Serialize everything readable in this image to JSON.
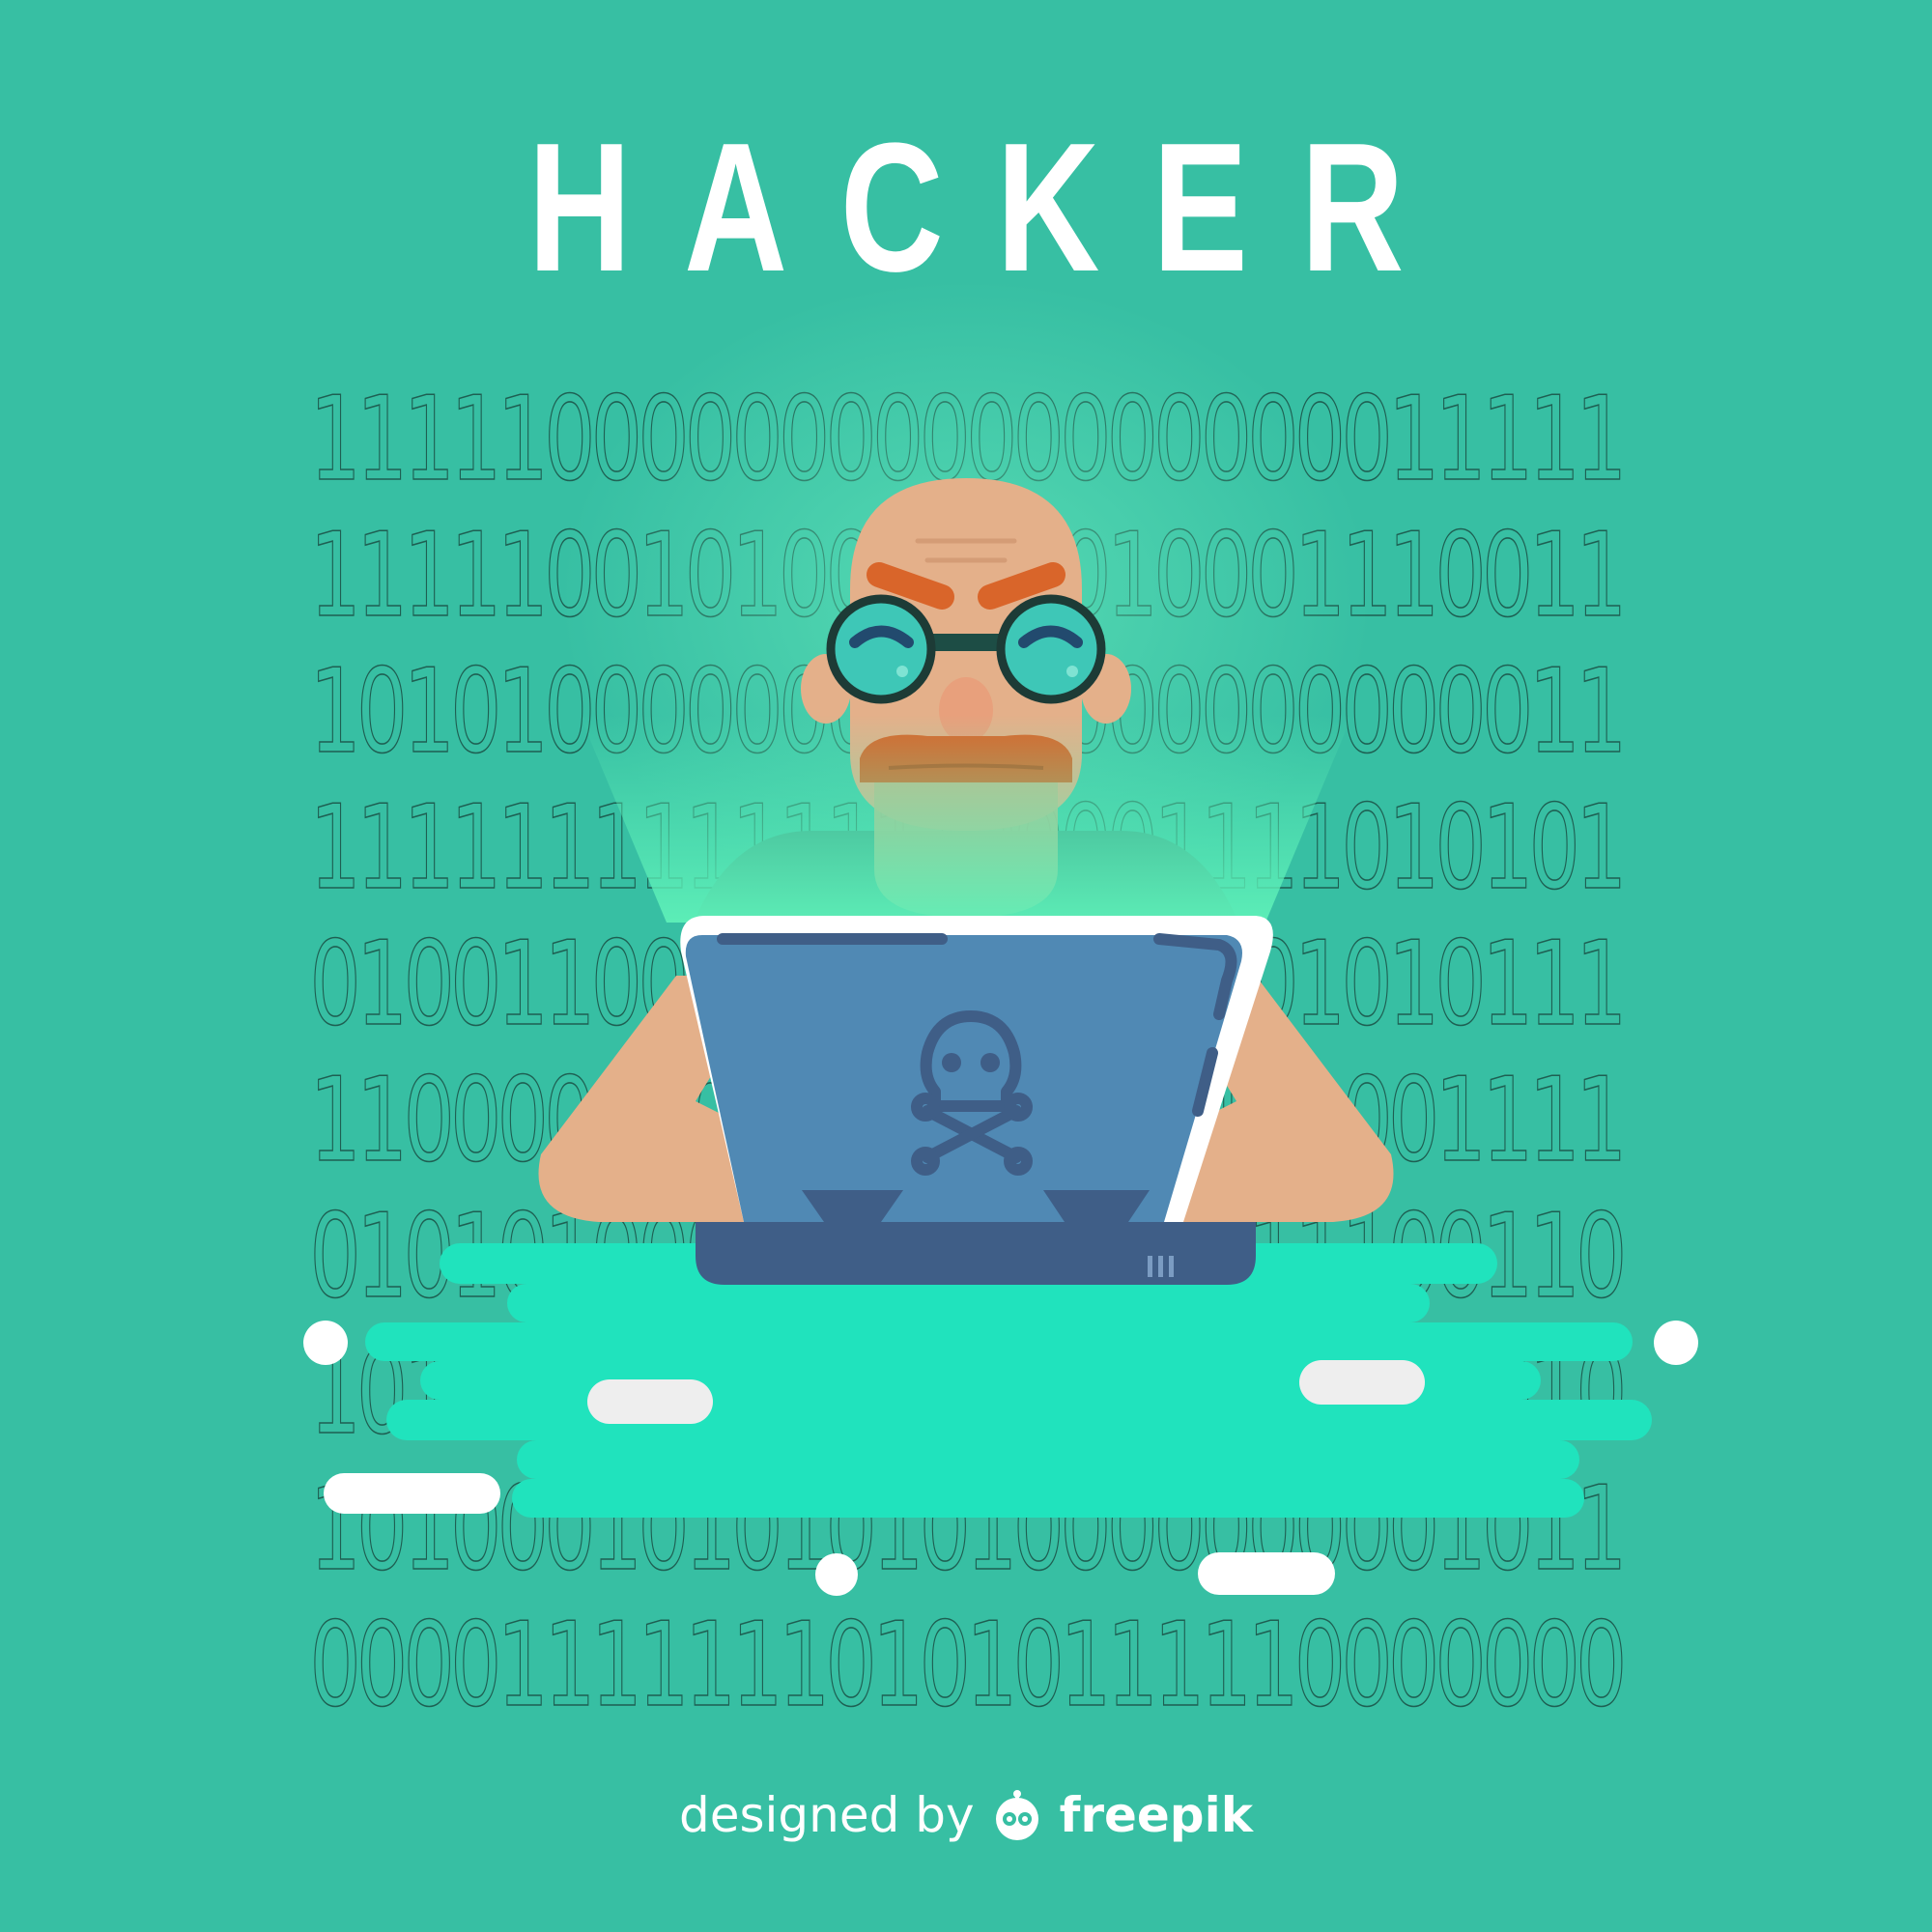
{
  "title": "HACKER",
  "binary_rows": [
    "1111100000000000000000011111",
    "1111100101001000010001110011",
    "1010100000001000000000000011",
    "1111111111111100001111010101",
    "0100110011100101100101010111",
    "1100001000101101000110001111",
    "0101010001101110110111100110",
    "1010101001011001100111001010",
    "1010001010101010000000001011",
    "0000111111101010111110000000"
  ],
  "credit": {
    "designed_by": "designed by",
    "brand": "freepik"
  },
  "colors": {
    "background": "#37bfa3",
    "desk_glow": "#20e3bd",
    "laptop_lid": "#5089b4",
    "laptop_base": "#3f5e87",
    "skin": "#e4b08a",
    "hair_orange": "#d9652a",
    "screen_glow": "#5ef0b8"
  },
  "icons": [
    "skull-crossbones-icon",
    "freepik-logo-icon"
  ]
}
